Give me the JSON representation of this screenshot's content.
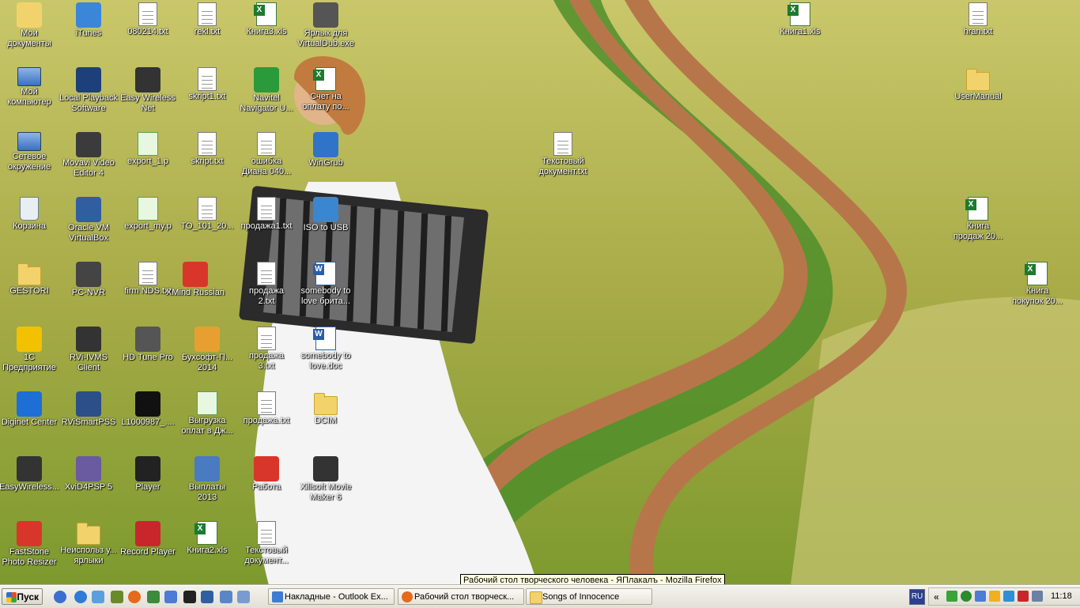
{
  "desktop": {
    "icons": [
      {
        "label": "Мои\nдокументы",
        "icon": "my-documents-icon"
      },
      {
        "label": "iTunes",
        "icon": "itunes-icon"
      },
      {
        "label": "080214.txt",
        "icon": "text-file-icon"
      },
      {
        "label": "rekl.txt",
        "icon": "text-file-icon"
      },
      {
        "label": "Книга3.xls",
        "icon": "excel-file-icon"
      },
      {
        "label": "Ярлык для\nVirtualDub.exe",
        "icon": "virtualdub-icon"
      },
      {
        "label": "Книга1.xls",
        "icon": "excel-file-icon"
      },
      {
        "label": "hran.txt",
        "icon": "text-file-icon"
      },
      {
        "label": "Мой\nкомпьютер",
        "icon": "my-computer-icon"
      },
      {
        "label": "Local Playback\nSoftware",
        "icon": "playback-software-icon"
      },
      {
        "label": "Easy Wireless\nNet",
        "icon": "wireless-net-icon"
      },
      {
        "label": "skript1.txt",
        "icon": "text-file-icon"
      },
      {
        "label": "Navitel\nNavigator U...",
        "icon": "navitel-icon"
      },
      {
        "label": "Счет на\nоплату по...",
        "icon": "excel-file-icon"
      },
      {
        "label": "UserManual",
        "icon": "folder-icon"
      },
      {
        "label": "Сетевое\nокружение",
        "icon": "network-icon"
      },
      {
        "label": "Movavi Video\nEditor 4",
        "icon": "movavi-icon"
      },
      {
        "label": "export_1.p",
        "icon": "export-file-icon"
      },
      {
        "label": "skript.txt",
        "icon": "text-file-icon"
      },
      {
        "label": "ошибка\nДиана 040...",
        "icon": "text-file-icon"
      },
      {
        "label": "WinGrub",
        "icon": "wingrub-icon"
      },
      {
        "label": "Текстовый\nдокумент.txt",
        "icon": "text-file-icon"
      },
      {
        "label": "Корзина",
        "icon": "recycle-bin-icon"
      },
      {
        "label": "Oracle VM\nVirtualBox",
        "icon": "virtualbox-icon"
      },
      {
        "label": "export_my.p",
        "icon": "export-file-icon"
      },
      {
        "label": "TO_101_20...",
        "icon": "text-file-icon"
      },
      {
        "label": "продажа1.txt",
        "icon": "text-file-icon"
      },
      {
        "label": "ISO to USB",
        "icon": "iso-to-usb-icon"
      },
      {
        "label": "Книга\nпродаж 20...",
        "icon": "excel-file-icon"
      },
      {
        "label": "GESTORI",
        "icon": "folder-icon"
      },
      {
        "label": "PC-NVR",
        "icon": "pc-nvr-icon"
      },
      {
        "label": "firm NDS.txt",
        "icon": "text-file-icon"
      },
      {
        "label": "XMind Russian",
        "icon": "xmind-icon"
      },
      {
        "label": "продажа\n2.txt",
        "icon": "text-file-icon"
      },
      {
        "label": "somebody to\nlove брита...",
        "icon": "word-file-icon"
      },
      {
        "label": "Книга\nпокупок 20...",
        "icon": "excel-file-icon"
      },
      {
        "label": "1С\nПредприятие",
        "icon": "1c-icon"
      },
      {
        "label": "RVi-IVMS\nClient",
        "icon": "ivms-icon"
      },
      {
        "label": "HD Tune Pro",
        "icon": "hd-tune-icon"
      },
      {
        "label": "Бухсофт-П...\n2014",
        "icon": "buhsoft-icon"
      },
      {
        "label": "продажа\n3.txt",
        "icon": "text-file-icon"
      },
      {
        "label": "somebody to\nlove.doc",
        "icon": "word-file-icon"
      },
      {
        "label": "Diginet Center",
        "icon": "diginet-icon"
      },
      {
        "label": "RViSmartPSS",
        "icon": "smartpss-icon"
      },
      {
        "label": "L1000987_....",
        "icon": "mp4-file-icon"
      },
      {
        "label": "Выгрузка\nоплат в Дж...",
        "icon": "export-file-icon"
      },
      {
        "label": "продажа.txt",
        "icon": "text-file-icon"
      },
      {
        "label": "DCIM",
        "icon": "folder-icon"
      },
      {
        "label": "EasyWireless...",
        "icon": "wireless-net-icon"
      },
      {
        "label": "XviD4PSP 5",
        "icon": "xvid-icon"
      },
      {
        "label": "Player",
        "icon": "player-icon"
      },
      {
        "label": "Выплаты\n2013",
        "icon": "archive-icon"
      },
      {
        "label": "Работа",
        "icon": "work-app-icon"
      },
      {
        "label": "Xilisoft Movie\nMaker 6",
        "icon": "xilisoft-icon"
      },
      {
        "label": "FastStone\nPhoto Resizer",
        "icon": "faststone-icon"
      },
      {
        "label": "Неиспольз у...\nярлыки",
        "icon": "folder-icon"
      },
      {
        "label": "Record Player",
        "icon": "record-player-icon"
      },
      {
        "label": "Книга2.xls",
        "icon": "excel-file-icon"
      },
      {
        "label": "Текстовый\nдокумент...",
        "icon": "text-file-icon"
      }
    ]
  },
  "tooltip": "Рабочий стол творческого человека - ЯПлакалъ - Mozilla Firefox",
  "taskbar": {
    "start_label": "Пуск",
    "tasks": [
      {
        "label": "Накладные - Outlook Ex...",
        "icon": "outlook-icon"
      },
      {
        "label": "Рабочий стол творческ...",
        "icon": "firefox-icon"
      },
      {
        "label": "Songs of Innocence",
        "icon": "folder-icon"
      }
    ],
    "language": "RU",
    "clock": "11:18"
  }
}
